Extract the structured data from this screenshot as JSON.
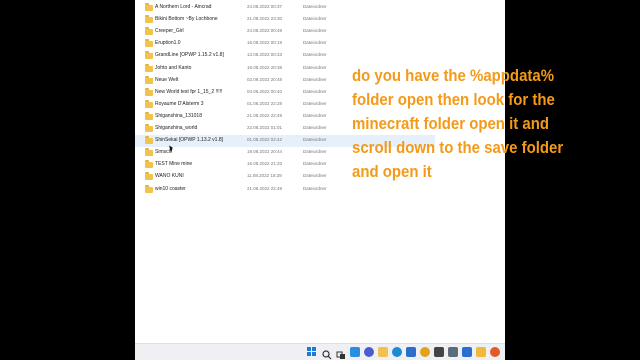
{
  "files": [
    {
      "name": "A Northern Lord - Aincrad",
      "date": "24.08.2022 00:37",
      "type": "Dateiordner"
    },
    {
      "name": "Bikini Bottom           ~By Lochbone",
      "date": "21.08.2022 23:30",
      "type": "Dateiordner"
    },
    {
      "name": "Creeper_Girl",
      "date": "24.08.2022 00:49",
      "type": "Dateiordner"
    },
    {
      "name": "Eruption1.0",
      "date": "16.08.2022 00:19",
      "type": "Dateiordner"
    },
    {
      "name": "GrandLine [OPWP 1.15.2 v1.8]",
      "date": "13.08.2022 00:33",
      "type": "Dateiordner"
    },
    {
      "name": "Johto and Kanto",
      "date": "19.08.2022 20:38",
      "type": "Dateiordner"
    },
    {
      "name": "Neue Welt",
      "date": "02.09.2022 20:48",
      "type": "Dateiordner"
    },
    {
      "name": "New World test fpr 1_15_2 !!!!!",
      "date": "04.06.2022 00:40",
      "type": "Dateiordner"
    },
    {
      "name": "Royaume D'Alsterm 3",
      "date": "01.06.2022 22:28",
      "type": "Dateiordner"
    },
    {
      "name": "Shiganshina_131018",
      "date": "21.08.2022 22:49",
      "type": "Dateiordner"
    },
    {
      "name": "Shiganshina_world",
      "date": "22.08.2022 01:01",
      "type": "Dateiordner"
    },
    {
      "name": "ShinSekai [OPWP 1.13.2 v1.8]",
      "date": "01.08.2022 02:42",
      "type": "Dateiordner",
      "selected": true
    },
    {
      "name": "Simsch",
      "date": "19.08.2022 20:44",
      "type": "Dateiordner"
    },
    {
      "name": "TEST Mine mine",
      "date": "15.08.2022 21:33",
      "type": "Dateiordner"
    },
    {
      "name": "WANO KUNI",
      "date": "11.08.2022 18:28",
      "type": "Dateiordner"
    },
    {
      "name": "win10 coaster",
      "date": "21.08.2022 22:49",
      "type": "Dateiordner"
    }
  ],
  "overlay": {
    "lines": [
      "do you have the %appdata%",
      "folder open then look for the",
      "minecraft folder open it and",
      "scroll down to the save folder",
      "and open it"
    ],
    "color": "#f39a18"
  },
  "taskbar": {
    "icons": [
      "start-icon",
      "search-icon",
      "task-view-icon",
      "widgets-icon",
      "chat-icon",
      "file-explorer-icon",
      "edge-icon",
      "store-icon",
      "app-icon",
      "app-icon",
      "app-icon",
      "app-icon",
      "app-icon",
      "app-icon"
    ]
  }
}
